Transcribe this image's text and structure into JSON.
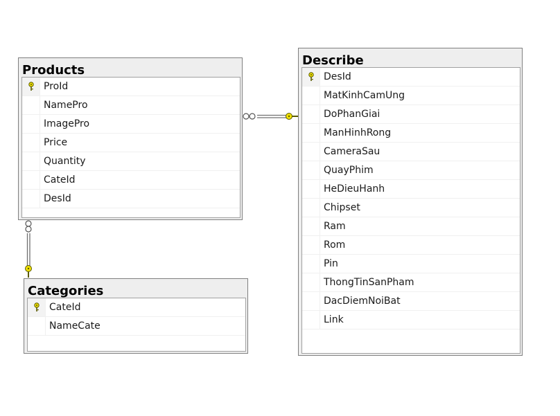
{
  "tables": {
    "products": {
      "name": "Products",
      "columns": [
        "ProId",
        "NamePro",
        "ImagePro",
        "Price",
        "Quantity",
        "CateId",
        "DesId"
      ],
      "primary_key": "ProId"
    },
    "categories": {
      "name": "Categories",
      "columns": [
        "CateId",
        "NameCate"
      ],
      "primary_key": "CateId"
    },
    "describe": {
      "name": "Describe",
      "columns": [
        "DesId",
        "MatKinhCamUng",
        "DoPhanGiai",
        "ManHinhRong",
        "CameraSau",
        "QuayPhim",
        "HeDieuHanh",
        "Chipset",
        "Ram",
        "Rom",
        "Pin",
        "ThongTinSanPham",
        "DacDiemNoiBat",
        "Link"
      ],
      "primary_key": "DesId"
    }
  },
  "relationships": [
    {
      "from": "Products",
      "to": "Describe",
      "many_end": "Products",
      "one_end": "Describe"
    },
    {
      "from": "Products",
      "to": "Categories",
      "many_end": "Products",
      "one_end": "Categories"
    }
  ],
  "colors": {
    "key_icon": "#f0e000",
    "connector": "#7f7f7f",
    "header_bg": "#eeeeee"
  }
}
